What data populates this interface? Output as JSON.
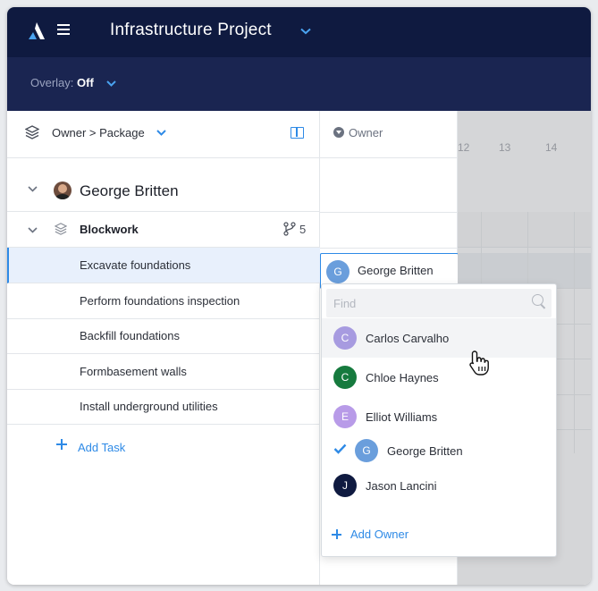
{
  "app": {
    "title": "Infrastructure Project",
    "overlay_label": "Overlay:",
    "overlay_value": "Off"
  },
  "groupby": {
    "label": "Owner > Package"
  },
  "owner_column": {
    "header": "Owner"
  },
  "timeline": {
    "days": [
      "12",
      "13",
      "14"
    ]
  },
  "owner_group": {
    "name": "George Britten"
  },
  "package": {
    "name": "Blockwork",
    "subtask_count": "5"
  },
  "tasks": [
    {
      "name": "Excavate foundations"
    },
    {
      "name": "Perform foundations inspection"
    },
    {
      "name": "Backfill foundations"
    },
    {
      "name": "Formbasement walls"
    },
    {
      "name": "Install underground utilities"
    }
  ],
  "add_task_label": "Add Task",
  "selected_owner": {
    "initial": "G",
    "name": "George Britten",
    "color": "#6a9edc"
  },
  "dropdown": {
    "search_placeholder": "Find",
    "options": [
      {
        "initial": "C",
        "name": "Carlos Carvalho",
        "color": "#a79be0"
      },
      {
        "initial": "C",
        "name": "Chloe Haynes",
        "color": "#167a3e"
      },
      {
        "initial": "E",
        "name": "Elliot Williams",
        "color": "#b89be8"
      },
      {
        "initial": "G",
        "name": "George Britten",
        "color": "#6a9edc"
      },
      {
        "initial": "J",
        "name": "Jason Lancini",
        "color": "#0f1a40"
      }
    ],
    "add_owner_label": "Add Owner"
  },
  "colors": {
    "accent": "#2e8ae6",
    "navbar": "#0f1a40",
    "subbar": "#1a2551"
  }
}
